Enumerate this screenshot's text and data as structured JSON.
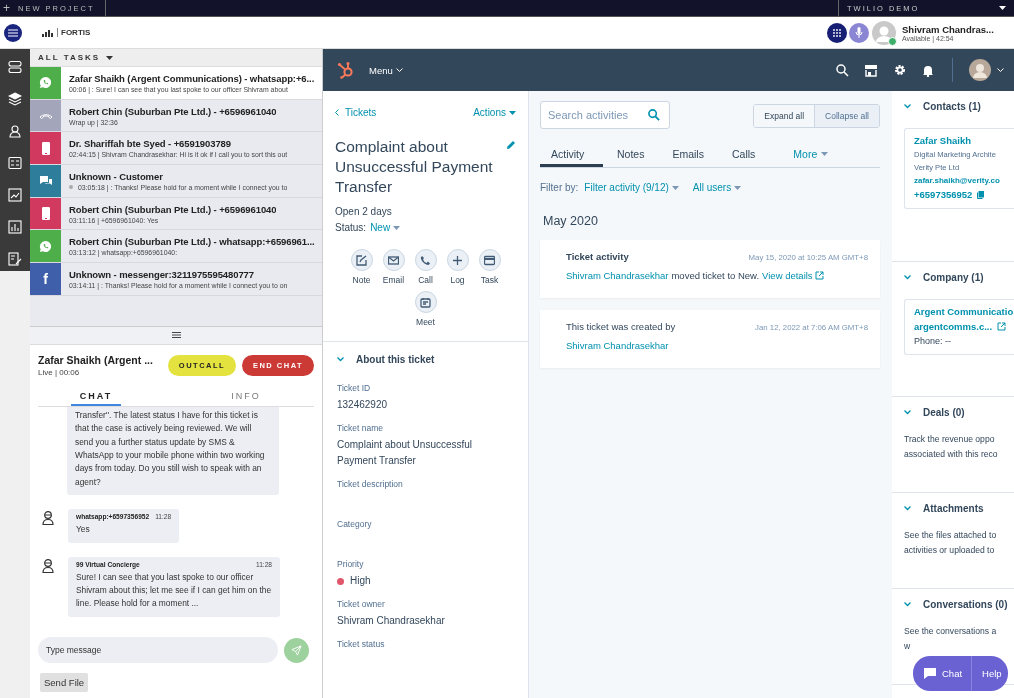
{
  "top_bar": {
    "plus": "+",
    "new_project": "NEW PROJECT",
    "workspace": "TWILIO DEMO"
  },
  "header": {
    "logo": "FORTIS",
    "agent": {
      "name": "Shivram Chandras...",
      "status": "Available | 42:54",
      "online": true
    }
  },
  "tasks": {
    "title": "ALL TASKS",
    "items": [
      {
        "kind": "whatsapp",
        "color": "#4dae4a",
        "title": "Zafar Shaikh (Argent Communications) - whatsapp:+6...",
        "detail": "00:06 | : Sure! I can see that you last spoke to our officer Shivram about",
        "dot": false,
        "selected": true
      },
      {
        "kind": "call",
        "color": "#a3a6ba",
        "title": "Robert Chin (Suburban Pte Ltd.) - +6596961040",
        "detail": "Wrap up | 32:36",
        "dot": false,
        "selected": false
      },
      {
        "kind": "mobile",
        "color": "#d13a5e",
        "title": "Dr. Shariffah bte Syed - +6591903789",
        "detail": "02:44:15 | Shivram Chandrasekhar: Hi is it ok if I call you to sort this out",
        "dot": false,
        "selected": false
      },
      {
        "kind": "chat",
        "color": "#2e7d9b",
        "title": "Unknown - Customer",
        "detail": "03:05:18 | : Thanks! Please hold for a moment while I connect you to",
        "dot": true,
        "selected": false
      },
      {
        "kind": "mobile",
        "color": "#d13a5e",
        "title": "Robert Chin (Suburban Pte Ltd.) - +6596961040",
        "detail": "03:11:16 | +6596961040: Yes",
        "dot": false,
        "selected": false
      },
      {
        "kind": "whatsapp",
        "color": "#4dae4a",
        "title": "Robert Chin (Suburban Pte Ltd.) - whatsapp:+6596961...",
        "detail": "03:13:12 | whatsapp:+6596961040:",
        "dot": false,
        "selected": false
      },
      {
        "kind": "messenger",
        "color": "#3f5faa",
        "glyph": "f",
        "title": "Unknown - messenger:3211975595480777",
        "detail": "03:14:11 | : Thanks! Please hold for a moment while I connect you to on",
        "dot": false,
        "selected": false
      }
    ]
  },
  "chat": {
    "title": "Zafar Shaikh (Argent ...",
    "status": "Live | 00:06",
    "buttons": [
      {
        "kind": "outcall",
        "label": "OUTCALL"
      },
      {
        "kind": "end",
        "label": "END CHAT"
      }
    ],
    "tabs": [
      {
        "label": "CHAT",
        "selected": true
      },
      {
        "label": "INFO",
        "selected": false
      }
    ],
    "messages": [
      {
        "kind": "continued",
        "text": "Transfer''. The latest status I have for this ticket is that the case is actively being reviewed. We will send you a further status update by SMS & WhatsApp to your mobile phone within two working days from today. Do you still wish to speak with an agent?"
      },
      {
        "kind": "message",
        "sender": "whatsapp:+6597356952",
        "time": "11:28",
        "text": "Yes"
      },
      {
        "kind": "message",
        "sender": "99 Virtual Concierge",
        "time": "11:28",
        "text": "Sure! I can see that you last spoke to our officer Shivram about this; let me see if I can get him on the line. Please hold for a moment ..."
      }
    ],
    "input": {
      "placeholder": "Type message"
    },
    "send_file": "Send File"
  },
  "crm_nav": {
    "menu": "Menu"
  },
  "ticket": {
    "back": "Tickets",
    "actions": "Actions",
    "title": "Complaint about Unsuccessful Payment Transfer",
    "age": "Open 2 days",
    "status_label": "Status:",
    "status": "New",
    "quick_actions": [
      {
        "kind": "note",
        "label": "Note"
      },
      {
        "kind": "email",
        "label": "Email"
      },
      {
        "kind": "call",
        "label": "Call"
      },
      {
        "kind": "log",
        "label": "Log"
      },
      {
        "kind": "task",
        "label": "Task"
      },
      {
        "kind": "meet",
        "label": "Meet"
      }
    ],
    "about": {
      "title": "About this ticket",
      "fields": [
        {
          "label": "Ticket ID",
          "value": "132462920"
        },
        {
          "label": "Ticket name",
          "value": "Complaint about Unsuccessful Payment Transfer"
        },
        {
          "label": "Ticket description"
        },
        {
          "label": "Category"
        },
        {
          "label": "Priority",
          "value": "High",
          "color": "#e0566b"
        },
        {
          "label": "Ticket owner",
          "value": "Shivram Chandrasekhar"
        },
        {
          "label": "Ticket status"
        }
      ]
    }
  },
  "activity": {
    "search": {
      "placeholder": "Search activities"
    },
    "view_buttons": [
      {
        "label": "Expand all",
        "selected": false
      },
      {
        "label": "Collapse all",
        "selected": true
      }
    ],
    "tabs": [
      {
        "kind": "tab",
        "label": "Activity",
        "selected": true
      },
      {
        "kind": "tab",
        "label": "Notes",
        "selected": false
      },
      {
        "kind": "tab",
        "label": "Emails",
        "selected": false
      },
      {
        "kind": "tab",
        "label": "Calls",
        "selected": false
      },
      {
        "kind": "dropdown",
        "label": "More",
        "selected": false
      }
    ],
    "filter_label": "Filter by:",
    "filters": [
      "Filter activity (9/12)",
      "All users"
    ],
    "month": "May 2020",
    "events": [
      {
        "kind": "activity",
        "title": "Ticket activity",
        "time": "May 15, 2020 at 10:25 AM GMT+8",
        "actor": "Shivram Chandrasekhar",
        "text": "moved ticket to New.",
        "link": "View details"
      },
      {
        "kind": "created",
        "text": "This ticket was created by",
        "actor": "Shivram Chandrasekhar",
        "time": "Jan 12, 2022 at 7:06 AM GMT+8"
      }
    ]
  },
  "sidebar": [
    {
      "kind": "contact",
      "title": "Contacts (1)",
      "name": "Zafar Shaikh",
      "job": "Digital Marketing Archite",
      "company": "Verity Pte Ltd",
      "email": "zafar.shaikh@verity.co",
      "phone": "+6597356952"
    },
    {
      "kind": "company",
      "title": "Company (1)",
      "name": "Argent Communicatio",
      "domain": "argentcomms.c...",
      "phone": "Phone: --"
    },
    {
      "kind": "text",
      "title": "Deals (0)",
      "lines": [
        "Track the revenue oppo",
        "associated with this reco"
      ]
    },
    {
      "kind": "text",
      "title": "Attachments",
      "lines": [
        "See the files attached to",
        "activities or uploaded to"
      ]
    },
    {
      "kind": "text",
      "title": "Conversations (0)",
      "lines": [
        "See the conversations a",
        "w"
      ]
    }
  ],
  "help_widget": {
    "chat": "Chat",
    "help": "Help"
  }
}
